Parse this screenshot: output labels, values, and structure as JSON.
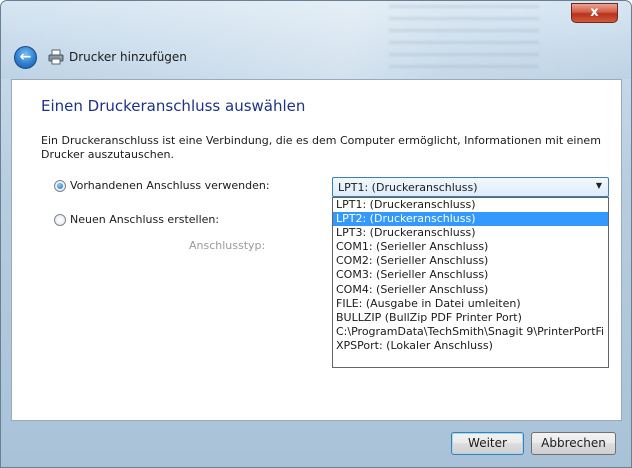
{
  "window": {
    "title": "Drucker hinzufügen",
    "close_label": "x"
  },
  "page": {
    "heading": "Einen Druckeranschluss auswählen",
    "description": "Ein Druckeranschluss ist eine Verbindung, die es dem Computer ermöglicht, Informationen mit einem Drucker auszutauschen."
  },
  "options": {
    "existing_port_label": "Vorhandenen Anschluss verwenden:",
    "existing_port_checked": true,
    "new_port_label": "Neuen Anschluss erstellen:",
    "new_port_checked": false,
    "port_type_label": "Anschlusstyp:"
  },
  "combo": {
    "selected_value": "LPT1: (Druckeranschluss)",
    "highlighted_index": 1,
    "items": [
      "LPT1: (Druckeranschluss)",
      "LPT2: (Druckeranschluss)",
      "LPT3: (Druckeranschluss)",
      "COM1: (Serieller Anschluss)",
      "COM2: (Serieller Anschluss)",
      "COM3: (Serieller Anschluss)",
      "COM4: (Serieller Anschluss)",
      "FILE: (Ausgabe in Datei umleiten)",
      "BULLZIP (BullZip PDF Printer Port)",
      "C:\\ProgramData\\TechSmith\\Snagit 9\\PrinterPortFi",
      "XPSPort: (Lokaler Anschluss)"
    ]
  },
  "buttons": {
    "next_label": "Weiter",
    "cancel_label": "Abbrechen"
  },
  "colors": {
    "heading": "#1e3287",
    "selection": "#3399ff",
    "close_button": "#c7432a"
  },
  "icons": {
    "back": "back-arrow-icon",
    "printer": "printer-icon",
    "close": "close-icon",
    "dropdown": "chevron-down-icon"
  }
}
